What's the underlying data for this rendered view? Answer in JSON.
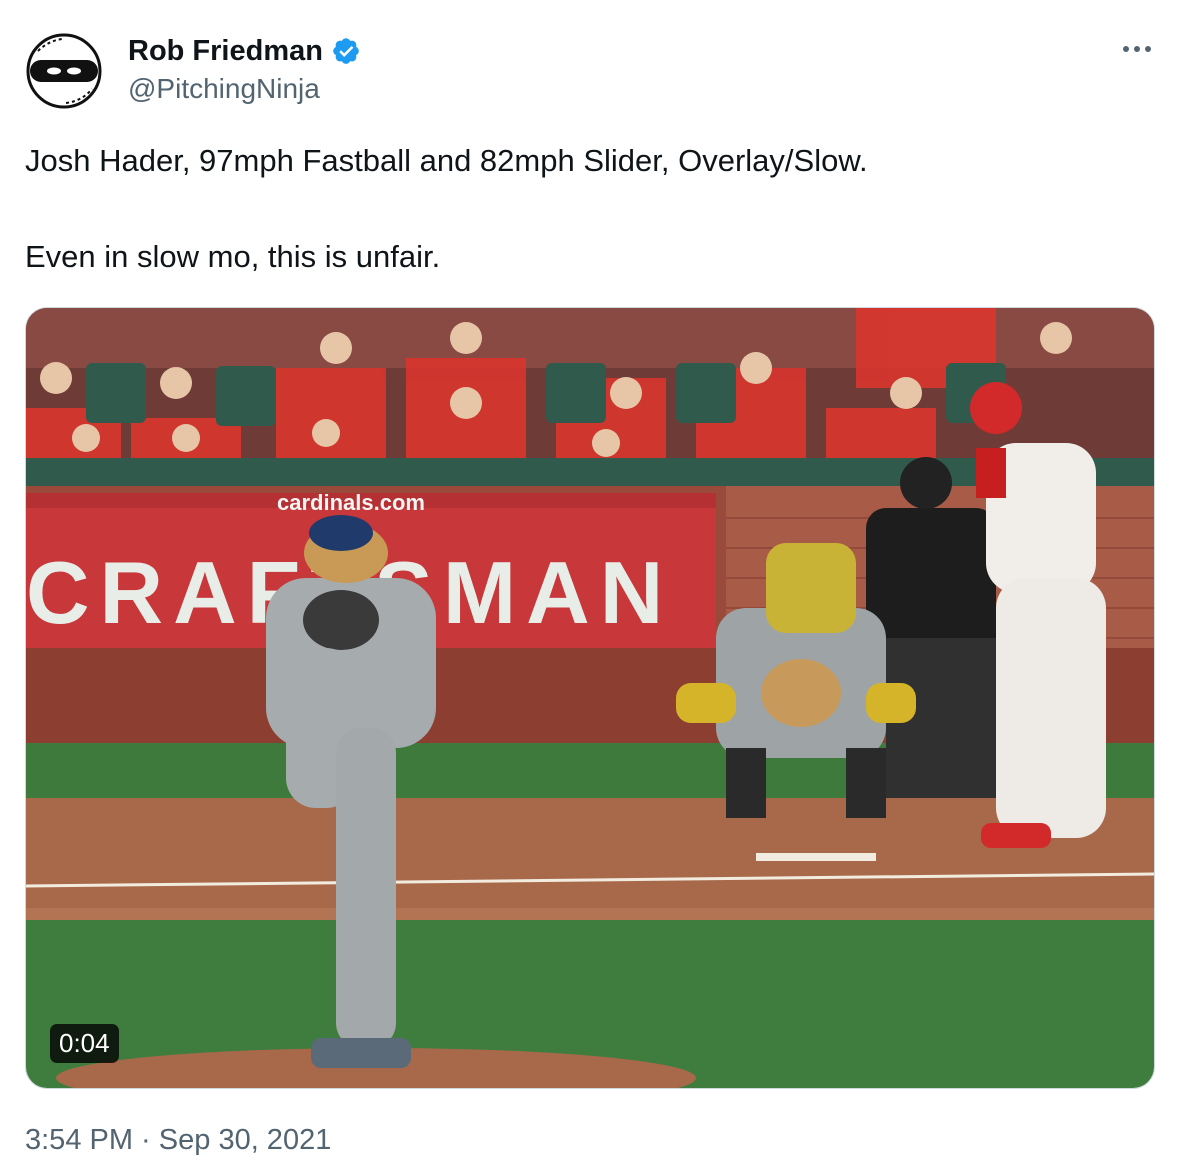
{
  "author": {
    "display_name": "Rob Friedman",
    "handle": "@PitchingNinja",
    "verified": true,
    "avatar_icon": "baseball-ninja-avatar-icon"
  },
  "more_icon": "more-horizontal-icon",
  "tweet": {
    "lines": [
      "Josh Hader, 97mph Fastball and 82mph Slider, Overlay/Slow.",
      "Even in slow mo, this is unfair."
    ]
  },
  "media": {
    "type": "video",
    "duration": "0:04",
    "wall_url_text": "cardinals.com",
    "sign_text": "CRAFTSMAN",
    "sign_mark": "®"
  },
  "meta": {
    "time": "3:54 PM",
    "separator": " · ",
    "date": "Sep 30, 2021"
  },
  "colors": {
    "text_primary": "#0f1419",
    "text_secondary": "#536471",
    "verified_blue": "#1d9bf0",
    "sign_red": "#c8383a"
  }
}
